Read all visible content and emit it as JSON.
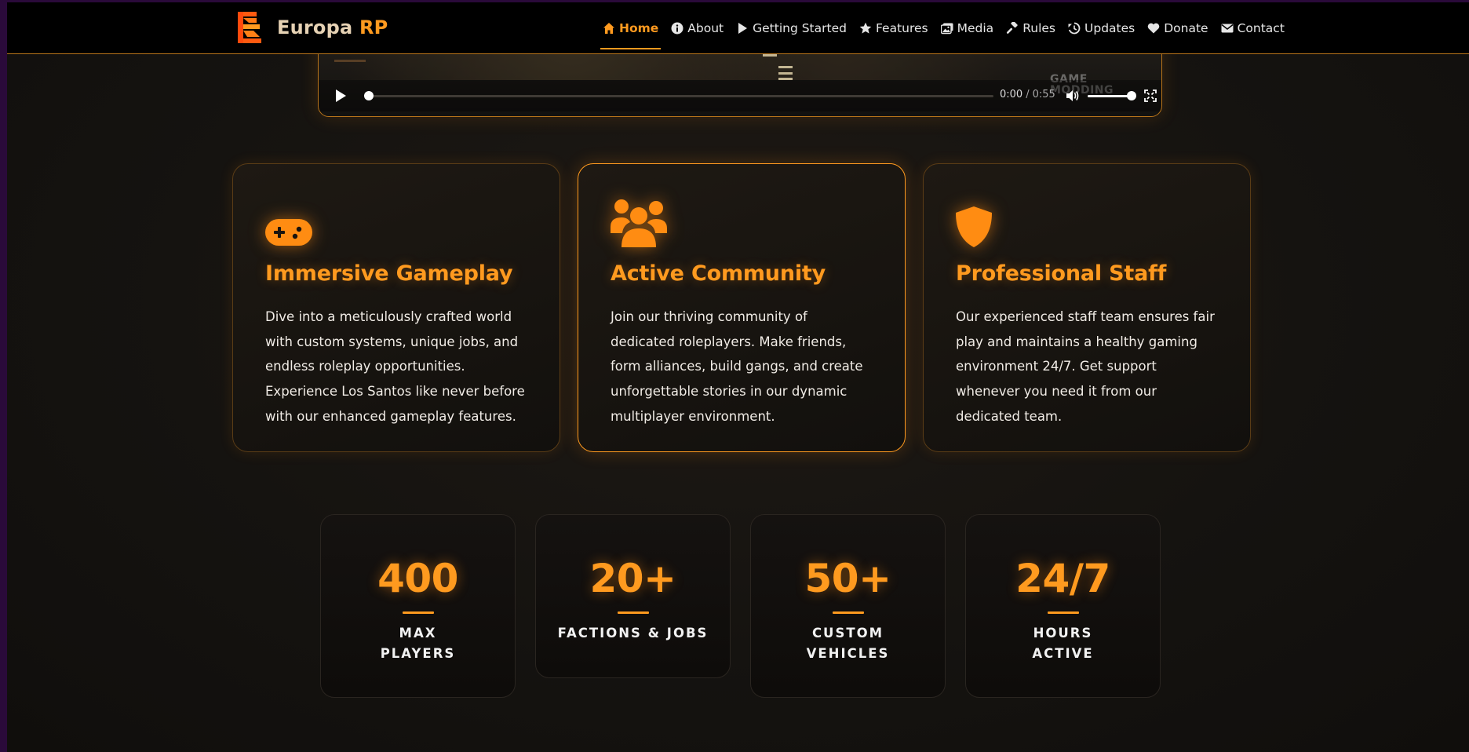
{
  "brand": {
    "name_main": "Europa",
    "name_accent": "RP"
  },
  "nav": {
    "items": [
      {
        "label": "Home",
        "icon": "home-icon",
        "active": true
      },
      {
        "label": "About",
        "icon": "info-icon"
      },
      {
        "label": "Getting Started",
        "icon": "play-icon"
      },
      {
        "label": "Features",
        "icon": "star-icon"
      },
      {
        "label": "Media",
        "icon": "images-icon"
      },
      {
        "label": "Rules",
        "icon": "gavel-icon"
      },
      {
        "label": "Updates",
        "icon": "history-icon"
      },
      {
        "label": "Donate",
        "icon": "heart-icon"
      },
      {
        "label": "Contact",
        "icon": "envelope-icon"
      }
    ]
  },
  "video": {
    "current_time": "0:00",
    "separator": "/",
    "duration": "0:55",
    "progress": 0,
    "volume": 1,
    "watermark_line1": "GAME",
    "watermark_line2": "MODDING"
  },
  "features": [
    {
      "icon": "gamepad-icon",
      "title": "Immersive Gameplay",
      "text": "Dive into a meticulously crafted world with custom systems, unique jobs, and endless roleplay opportunities. Experience Los Santos like never before with our enhanced gameplay features."
    },
    {
      "icon": "users-icon",
      "title": "Active Community",
      "text": "Join our thriving community of dedicated roleplayers. Make friends, form alliances, build gangs, and create unforgettable stories in our dynamic multiplayer environment."
    },
    {
      "icon": "shield-icon",
      "title": "Professional Staff",
      "text": "Our experienced staff team ensures fair play and maintains a healthy gaming environment 24/7. Get support whenever you need it from our dedicated team."
    }
  ],
  "stats": [
    {
      "value": "400",
      "label_line1": "MAX",
      "label_line2": "PLAYERS"
    },
    {
      "value": "20+",
      "label_line1": "FACTIONS & JOBS",
      "label_line2": ""
    },
    {
      "value": "50+",
      "label_line1": "CUSTOM",
      "label_line2": "VEHICLES"
    },
    {
      "value": "24/7",
      "label_line1": "HOURS",
      "label_line2": "ACTIVE"
    }
  ],
  "colors": {
    "accent": "#ff9a1f",
    "nav_bg": "#000000",
    "page_bg": "#151310",
    "frame": "#2a0a3a"
  }
}
